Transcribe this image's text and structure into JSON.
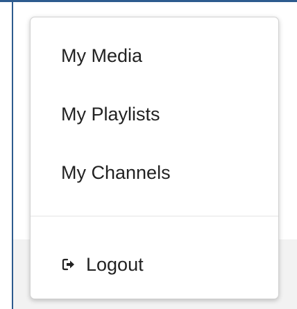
{
  "menu": {
    "items": [
      {
        "label": "My Media"
      },
      {
        "label": "My Playlists"
      },
      {
        "label": "My Channels"
      }
    ],
    "logout": {
      "label": "Logout",
      "icon": "logout-icon"
    }
  }
}
